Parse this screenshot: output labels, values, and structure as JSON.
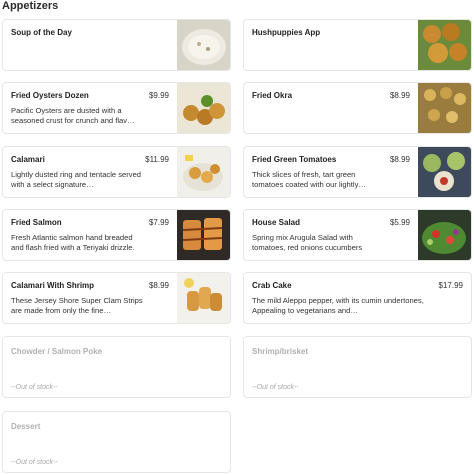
{
  "section": {
    "title": "Appetizers"
  },
  "items": [
    {
      "name": "Soup of the Day",
      "price": "",
      "description": ""
    },
    {
      "name": "Hushpuppies App",
      "price": "",
      "description": ""
    },
    {
      "name": "Fried Oysters Dozen",
      "price": "$9.99",
      "description": "Pacific Oysters are dusted with a seasoned crust for crunch and flav…"
    },
    {
      "name": "Fried Okra",
      "price": "$8.99",
      "description": ""
    },
    {
      "name": "Calamari",
      "price": "$11.99",
      "description": "Lightly dusted ring and tentacle served with a select signature…"
    },
    {
      "name": "Fried Green Tomatoes",
      "price": "$8.99",
      "description": "Thick slices of fresh, tart green tomatoes coated with our lightly…"
    },
    {
      "name": "Fried Salmon",
      "price": "$7.99",
      "description": "Fresh Atlantic salmon hand breaded and flash fried with a Teriyaki drizzle."
    },
    {
      "name": "House Salad",
      "price": "$5.99",
      "description": "Spring mix Arugula Salad with tomatoes, red onions cucumbers"
    },
    {
      "name": "Calamari With Shrimp",
      "price": "$8.99",
      "description": "These Jersey Shore Super Clam Strips are made from only the fine…"
    },
    {
      "name": "Crab Cake",
      "price": "$17.99",
      "description": "The mild Aleppo pepper, with its cumin undertones, Appealing to vegetarians and…"
    }
  ],
  "out_of_stock": [
    {
      "name": "Chowder / Salmon Poke",
      "status": "--Out of stock--"
    },
    {
      "name": "Shrimp/brisket",
      "status": "--Out of stock--"
    },
    {
      "name": "Dessert",
      "status": "--Out of stock--"
    }
  ]
}
